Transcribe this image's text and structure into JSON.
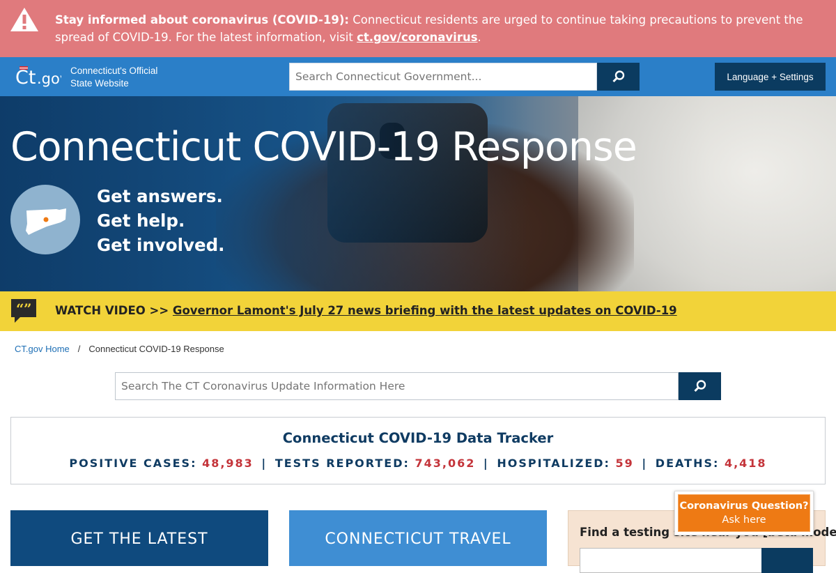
{
  "alert": {
    "icon": "warning-icon",
    "heading": "Stay informed about coronavirus (COVID-19):",
    "message": " Connecticut residents are urged to continue taking precautions to prevent the spread of COVID-19. For the latest information, visit ",
    "link": "ct.gov/coronavirus",
    "trailing": ".",
    "color": "#e07a7d"
  },
  "header": {
    "logo_text": "Ct.gov",
    "site_title_line1": "Connecticut's Official",
    "site_title_line2": "State Website",
    "search_placeholder": "Search Connecticut Government...",
    "search_icon": "search-icon",
    "language_button": "Language + Settings",
    "color": "#2b7fc8"
  },
  "hero": {
    "title": "Connecticut COVID-19 Response",
    "taglines": [
      "Get answers.",
      "Get help.",
      "Get involved."
    ],
    "map_icon": "connecticut-map-icon"
  },
  "video_bar": {
    "icon": "quote-icon",
    "prefix": "WATCH VIDEO >> ",
    "link": "Governor Lamont's July 27 news briefing with the latest updates on COVID-19",
    "color": "#f2d339"
  },
  "breadcrumb": {
    "home": "CT.gov Home",
    "separator": "/",
    "current": "Connecticut COVID-19 Response"
  },
  "main_search": {
    "placeholder": "Search The CT Coronavirus Update Information Here"
  },
  "tracker": {
    "title": "Connecticut COVID-19 Data Tracker",
    "stats": [
      {
        "label": "POSITIVE CASES:",
        "value": "48,983"
      },
      {
        "label": "TESTS REPORTED:",
        "value": "743,062"
      },
      {
        "label": "HOSPITALIZED:",
        "value": "59"
      },
      {
        "label": "DEATHS:",
        "value": "4,418"
      }
    ],
    "separator": "|",
    "value_color": "#c4343a"
  },
  "cards": {
    "latest": "GET THE LATEST",
    "travel": "CONNECTICUT TRAVEL",
    "testing": {
      "title": "Find a testing site near you [beta mode]"
    }
  },
  "question_button": {
    "title": "Coronavirus Question?",
    "subtitle": "Ask here",
    "color": "#ee7a14"
  }
}
